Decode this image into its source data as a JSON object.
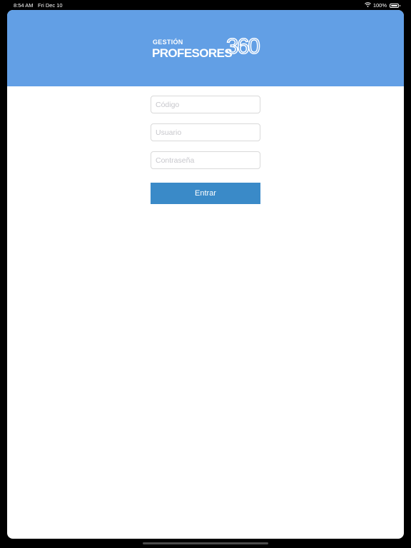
{
  "status_bar": {
    "time": "8:54 AM",
    "date": "Fri Dec 10",
    "battery_text": "100%",
    "wifi_icon": "wifi-icon",
    "battery_icon": "battery-icon"
  },
  "header": {
    "background_color": "#629fe5",
    "logo": {
      "line1": "GESTIÓN",
      "line2": "PROFESORES",
      "number": "360"
    }
  },
  "form": {
    "code_field": {
      "placeholder": "Código",
      "value": ""
    },
    "user_field": {
      "placeholder": "Usuario",
      "value": ""
    },
    "password_field": {
      "placeholder": "Contraseña",
      "value": ""
    },
    "submit_label": "Entrar",
    "submit_color": "#3a8ac8"
  }
}
